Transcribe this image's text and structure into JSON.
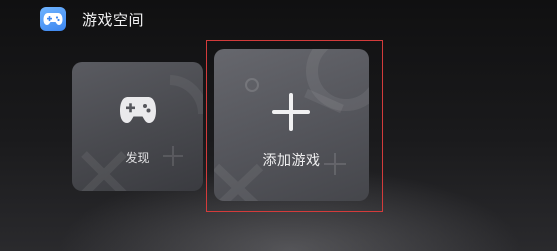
{
  "header": {
    "title": "游戏空间",
    "logo_icon": "game-space-logo"
  },
  "cards": {
    "discover": {
      "label": "发现",
      "icon": "gamepad-icon"
    },
    "add_game": {
      "label": "添加游戏",
      "icon": "plus-icon"
    }
  },
  "colors": {
    "logo_blue": "#4a93f5",
    "focus_ring": "#d33b3b",
    "card_surface": "#55565c",
    "background": "#151516"
  }
}
